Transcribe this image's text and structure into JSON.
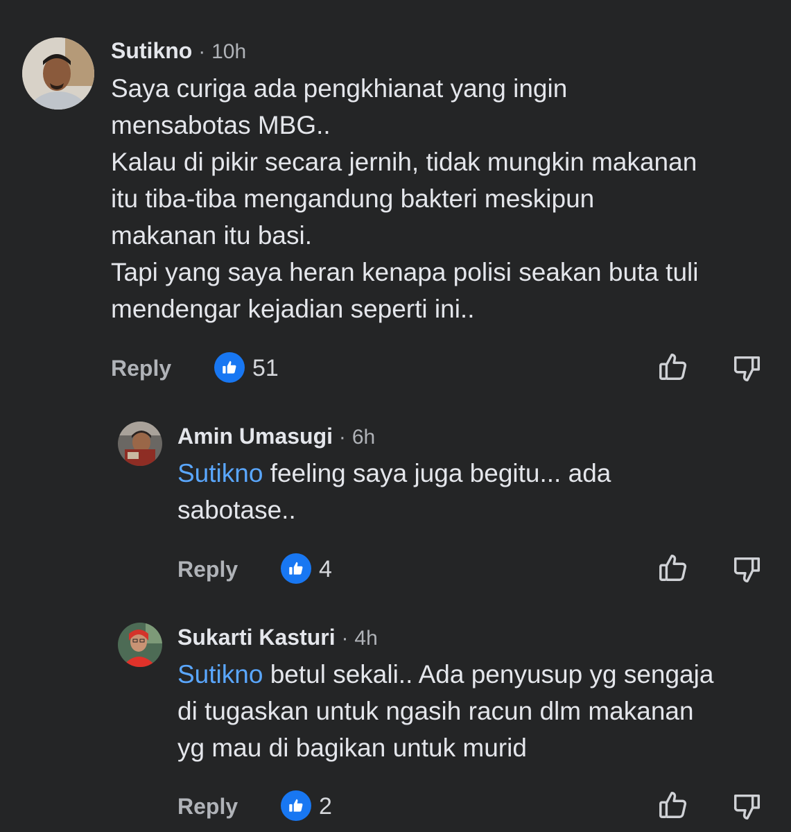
{
  "comments": [
    {
      "author": "Sutikno",
      "separator": "·",
      "time": "10h",
      "mention": "",
      "lines": [
        "Saya curiga ada pengkhianat yang ingin",
        "mensabotas MBG..",
        "Kalau di pikir secara jernih, tidak mungkin makanan",
        "itu tiba-tiba mengandung bakteri meskipun",
        "makanan itu basi.",
        "Tapi yang saya heran kenapa polisi seakan buta tuli",
        "mendengar kejadian seperti ini.."
      ],
      "reply_label": "Reply",
      "like_count": "51"
    },
    {
      "author": "Amin Umasugi",
      "separator": "·",
      "time": "6h",
      "mention": "Sutikno",
      "lines": [
        " feeling saya juga begitu... ada",
        "sabotase.."
      ],
      "reply_label": "Reply",
      "like_count": "4"
    },
    {
      "author": "Sukarti Kasturi",
      "separator": "·",
      "time": "4h",
      "mention": "Sutikno",
      "lines": [
        " betul sekali.. Ada penyusup yg sengaja",
        "di tugaskan untuk ngasih racun dlm makanan",
        "yg mau di bagikan untuk murid"
      ],
      "reply_label": "Reply",
      "like_count": "2"
    }
  ],
  "icons": {
    "like_badge": "thumbs-up-filled-icon",
    "like_action": "thumbs-up-outline-icon",
    "dislike_action": "thumbs-down-outline-icon"
  },
  "colors": {
    "background": "#242526",
    "mention": "#5aa7ff",
    "like_badge": "#1877f2",
    "secondary_text": "#b0b3b8"
  }
}
